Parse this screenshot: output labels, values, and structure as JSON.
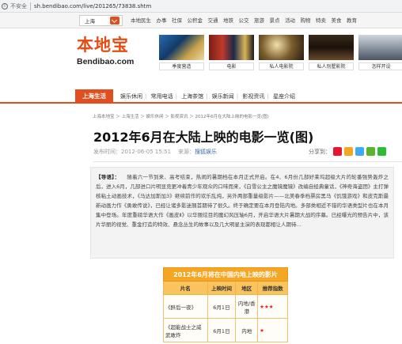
{
  "browser": {
    "security": "不安全",
    "url": "sh.bendibao.com/live/201265/73838.shtm"
  },
  "topnav": {
    "city": "上海",
    "links": [
      "本地民生",
      "办事",
      "社保",
      "公积金",
      "交通",
      "地铁",
      "公交",
      "旅游",
      "景点",
      "活动",
      "购物",
      "特卖",
      "美食",
      "教育"
    ]
  },
  "logo": {
    "cn": "本地宝",
    "en": "Bendibao.com"
  },
  "banners": [
    "季度营造",
    "电影",
    "私人电影院",
    "私人别墅影院",
    "怎样开设"
  ],
  "channel": {
    "home": "上海生活",
    "links": [
      "娱乐休闲",
      "常用电话",
      "上海茶馆",
      "娱乐新闻",
      "影视资讯",
      "星座介绍"
    ]
  },
  "breadcrumb": "上海本地宝 ＞ 上海生活 ＞ 娱乐休闲 ＞ 影视资讯 ＞ 2012年6月在大陆上映的电影一览(图)",
  "article": {
    "title": "2012年6月在大陆上映的电影一览(图)",
    "publish_label": "发布时间：2012-06-05 15:51",
    "source_label": "来源：",
    "source": "搜狐娱乐",
    "share_label": "分享到：",
    "intro_label": "【导语】：",
    "intro": "随着六一节到来、高考结束，热闹的暑期档在本月正式开启。在4、6月份几部好莱坞超级大片的轮番强势轰炸之后，进入6月，几部进口片明显竞更冲着青少年观众的口味而来，《白雪公主之魔镜魔镜》改编自经典童话，《神奇海盗团》主打弹核粘土动画技术，《马达加斯加3》继续前作的欢乐乱炖，另外两部重量级影片——北美春季档票房黑马《饥饿游戏》和皮克斯最新动画力作《勇敢传说》，已经让诸多影迷翘首期待了很久。终于确定要在本月登陆内地。多部类相近不错的华语类型片也在本月集中登场。年度重磅华语大作《画皮Ⅱ》以华丽炫目的魔幻风压轴6月，开启华语大片暑期大战的序幕。已经曝光的预告片中，该片华丽的视觉、重金打造的特效、悬念丛生的故事以及几大明星主演的表现都相让人期待…"
  },
  "table": {
    "title": "2012年6月将在中国内地上映的影片",
    "headers": [
      "片名",
      "上映时间",
      "地区",
      "推荐指数"
    ],
    "rows": [
      {
        "name": "《醉后一夜》",
        "date": "6月1日",
        "region": "内地/香港",
        "stars": "★★★"
      },
      {
        "name": "《超能战士之威武敢炸",
        "date": "6月1日",
        "region": "内地",
        "stars": "★"
      }
    ]
  },
  "colors": {
    "brand": "#e24f1e",
    "table_head": "#f5a623"
  }
}
